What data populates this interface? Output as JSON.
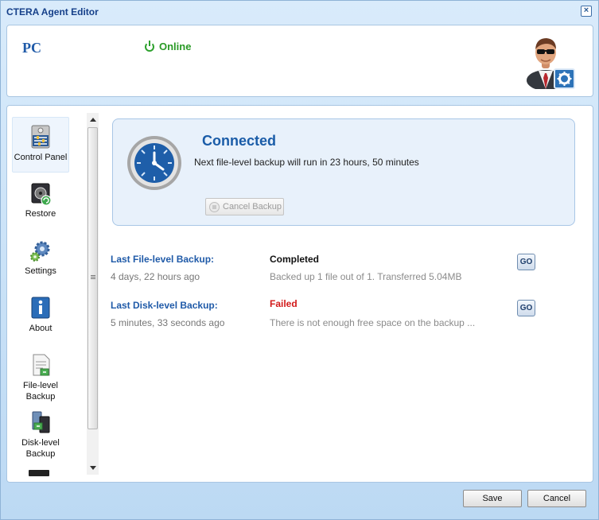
{
  "window": {
    "title": "CTERA Agent Editor"
  },
  "header": {
    "device_name": "PC",
    "status": "Online"
  },
  "sidebar": {
    "items": [
      {
        "label": "Control Panel"
      },
      {
        "label": "Restore"
      },
      {
        "label": "Settings"
      },
      {
        "label": "About"
      },
      {
        "label": "File-level Backup"
      },
      {
        "label": "Disk-level Backup"
      }
    ]
  },
  "status_box": {
    "title": "Connected",
    "next_backup": "Next file-level backup will run in 23 hours, 50 minutes",
    "cancel_label": "Cancel Backup"
  },
  "backups": [
    {
      "label": "Last File-level Backup:",
      "ago": "4 days, 22 hours ago",
      "status": "Completed",
      "detail": "Backed up 1 file out of 1. Transferred 5.04MB",
      "go_label": "GO"
    },
    {
      "label": "Last Disk-level Backup:",
      "ago": "5 minutes, 33 seconds ago",
      "status": "Failed",
      "detail": "There is not enough free space on the backup ...",
      "go_label": "GO"
    }
  ],
  "footer": {
    "save_label": "Save",
    "cancel_label": "Cancel"
  },
  "colors": {
    "accent": "#1f5aa8",
    "online": "#2a9a26",
    "failed": "#d21a1a"
  },
  "icons": {
    "close": "close-icon",
    "status": "power-icon",
    "avatar": "user-settings-avatar",
    "clock": "clock-icon"
  }
}
